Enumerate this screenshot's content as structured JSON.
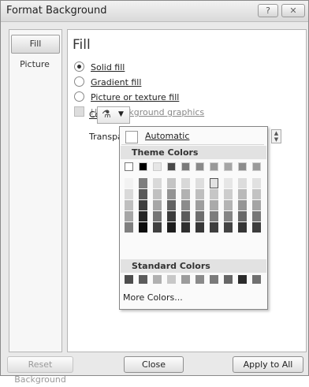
{
  "title": "Format Background",
  "title_buttons": {
    "help": "?",
    "close": "✕"
  },
  "nav": [
    {
      "label": "Fill",
      "selected": true
    },
    {
      "label": "Picture",
      "selected": false
    }
  ],
  "heading": "Fill",
  "options": {
    "solid_fill": "Solid fill",
    "gradient_fill": "Gradient fill",
    "picture_fill": "Picture or texture fill",
    "hide_graphics": "Hide background graphics"
  },
  "color_label": "Color:",
  "transparency_label": "Transpa",
  "icons": {
    "bucket": "paint-bucket",
    "caret": "▼",
    "spin_up": "▲",
    "spin_down": "▼"
  },
  "popup": {
    "automatic": "Automatic",
    "theme_colors": "Theme Colors",
    "standard_colors": "Standard Colors",
    "more_colors": "More Colors...",
    "theme_top_row": [
      "#ffffff",
      "#000000",
      "#e6e6e6",
      "#4a4a4a",
      "#7b7b7b",
      "#8a8a8a",
      "#999999",
      "#a6a6a6",
      "#8c8c8c",
      "#9a9a9a"
    ],
    "theme_columns": [
      [
        "#f2f2f2",
        "#d9d9d9",
        "#bfbfbf",
        "#a6a6a6",
        "#7f7f7f"
      ],
      [
        "#7f7f7f",
        "#595959",
        "#3f3f3f",
        "#262626",
        "#0d0d0d"
      ],
      [
        "#d9d9d9",
        "#c0c0c0",
        "#a6a6a6",
        "#757575",
        "#404040"
      ],
      [
        "#c4c4c4",
        "#939393",
        "#626262",
        "#3b3b3b",
        "#1d1d1d"
      ],
      [
        "#d8d8d8",
        "#b2b2b2",
        "#8c8c8c",
        "#5c5c5c",
        "#2e2e2e"
      ],
      [
        "#dedede",
        "#bebebe",
        "#9e9e9e",
        "#6e6e6e",
        "#373737"
      ],
      [
        "#e2e2e2",
        "#c6c6c6",
        "#aaaaaa",
        "#7d7d7d",
        "#3e3e3e"
      ],
      [
        "#e6e6e6",
        "#cdcdcd",
        "#b4b4b4",
        "#858585",
        "#434343"
      ],
      [
        "#dcdcdc",
        "#b9b9b9",
        "#969696",
        "#696969",
        "#353535"
      ],
      [
        "#e1e1e1",
        "#c3c3c3",
        "#a5a5a5",
        "#777777",
        "#3c3c3c"
      ]
    ],
    "standard_row": [
      "#4d4d4d",
      "#5c5c5c",
      "#b0b0b0",
      "#c8c8c8",
      "#9c9c9c",
      "#8a8a8a",
      "#7a7a7a",
      "#666666",
      "#2b2b2b",
      "#707070"
    ]
  },
  "buttons": {
    "reset": "Reset Background",
    "close": "Close",
    "apply_all": "Apply to All"
  }
}
